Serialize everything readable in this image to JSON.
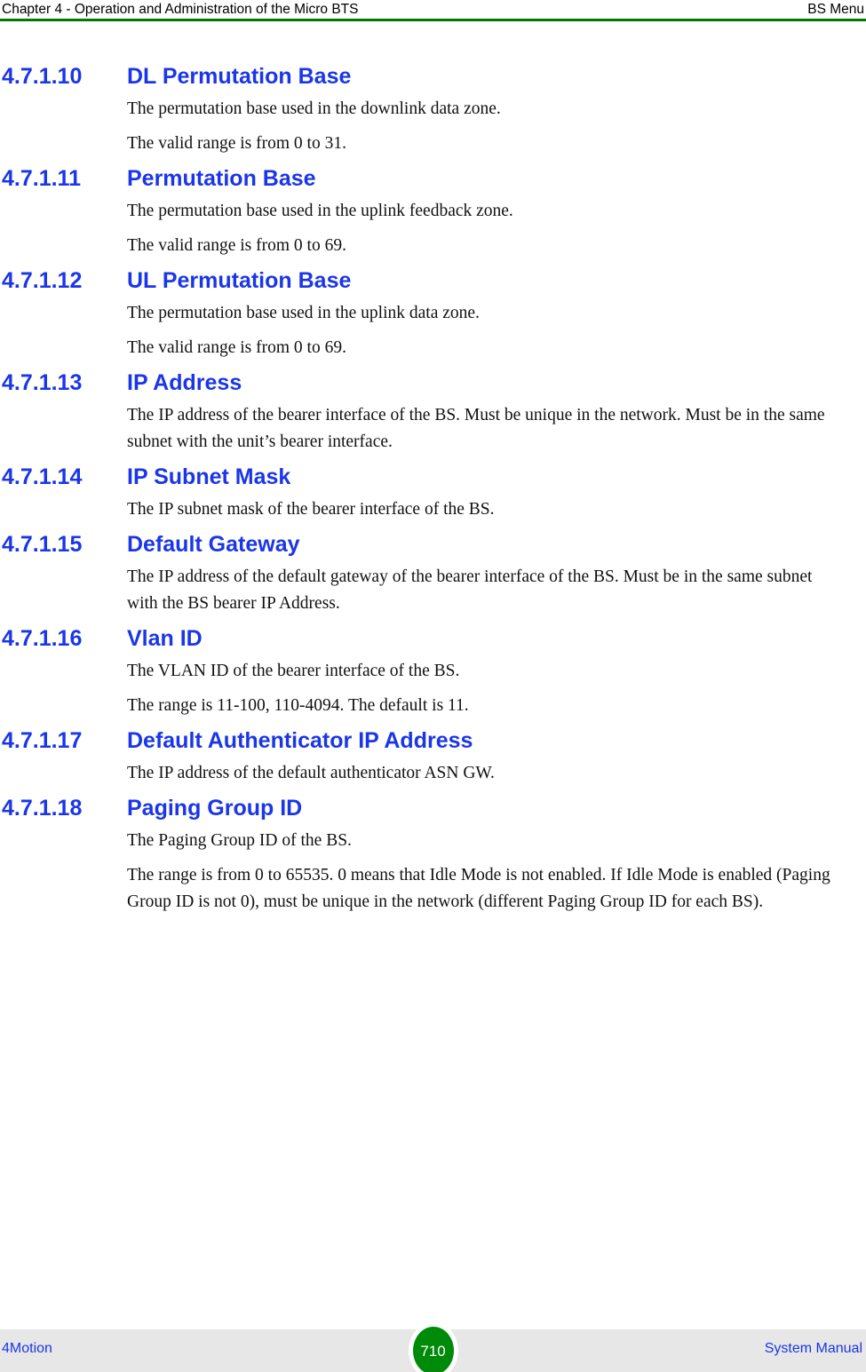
{
  "header": {
    "left": "Chapter 4 - Operation and Administration of the Micro BTS",
    "right": "BS Menu",
    "rule_color": "#007a00"
  },
  "footer": {
    "left": "4Motion",
    "right": "System Manual",
    "page_number": "710",
    "badge_color": "#008a09",
    "band_color": "#e7e7e7",
    "link_color": "#1a36e8"
  },
  "theme": {
    "heading_color": "#1a36e8",
    "body_color": "#111111",
    "page_background": "#ffffff"
  },
  "sections": [
    {
      "number": "4.7.1.10",
      "title": "DL Permutation Base",
      "paragraphs": [
        "The permutation base used in the downlink data zone.",
        "The valid range is from 0 to 31."
      ]
    },
    {
      "number": "4.7.1.11",
      "title": "Permutation Base",
      "paragraphs": [
        "The permutation base used in the uplink feedback zone.",
        "The valid range is from 0 to 69."
      ]
    },
    {
      "number": "4.7.1.12",
      "title": "UL Permutation Base",
      "paragraphs": [
        "The permutation base used in the uplink data zone.",
        "The valid range is from 0 to 69."
      ]
    },
    {
      "number": "4.7.1.13",
      "title": "IP Address",
      "paragraphs": [
        "The IP address of the bearer interface of the BS. Must be unique in the network. Must be in the same subnet with the unit’s bearer interface."
      ]
    },
    {
      "number": "4.7.1.14",
      "title": "IP Subnet Mask",
      "paragraphs": [
        "The IP subnet mask of the bearer interface of the BS."
      ]
    },
    {
      "number": "4.7.1.15",
      "title": "Default Gateway",
      "paragraphs": [
        "The IP address of the default gateway of the bearer interface of the BS. Must be in the same subnet with the BS bearer IP Address."
      ]
    },
    {
      "number": "4.7.1.16",
      "title": "Vlan ID",
      "paragraphs": [
        "The VLAN ID of the bearer interface of the BS.",
        "The range is 11-100, 110-4094. The default is 11."
      ]
    },
    {
      "number": "4.7.1.17",
      "title": "Default Authenticator IP Address",
      "paragraphs": [
        "The IP address of the default authenticator ASN GW."
      ]
    },
    {
      "number": "4.7.1.18",
      "title": "Paging Group ID",
      "paragraphs": [
        "The Paging Group ID of the BS.",
        "The range is from 0 to 65535. 0 means that Idle Mode is not enabled. If Idle Mode is enabled (Paging Group ID is not 0), must be unique in the network (different Paging Group ID for each BS)."
      ]
    }
  ]
}
